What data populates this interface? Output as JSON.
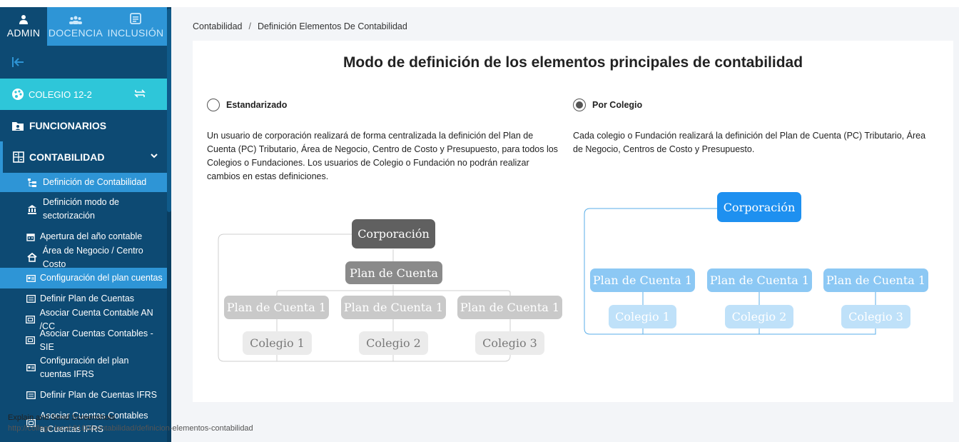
{
  "sidebar": {
    "tabs": [
      {
        "label": "ADMIN",
        "icon": "admin-user-icon"
      },
      {
        "label": "DOCENCIA",
        "icon": "group-icon"
      },
      {
        "label": "INCLUSIÓN",
        "icon": "id-card-icon"
      }
    ],
    "back_icon": "arrow-left-icon",
    "colegio": {
      "label": "COLEGIO 12-2",
      "icon": "palette-icon",
      "swap_icon": "swap-icon"
    },
    "funcionarios": {
      "label": "FUNCIONARIOS",
      "icon": "folder-user-icon"
    },
    "contabilidad": {
      "label": "CONTABILIDAD",
      "icon": "calculator-icon",
      "chevron": "chevron-down-icon"
    },
    "sub_items": [
      {
        "label": "Definición de Contabilidad",
        "active": true,
        "icon": "tree-icon"
      },
      {
        "label": "Definición modo de sectorización",
        "active": false,
        "icon": "bank-icon"
      },
      {
        "label": "Apertura del año contable",
        "active": false,
        "icon": "calendar-icon"
      },
      {
        "label": "Área de Negocio / Centro Costo",
        "active": false,
        "icon": "home-icon"
      },
      {
        "label": "Configuración del plan cuentas",
        "active": true,
        "icon": "card-icon"
      },
      {
        "label": "Definir Plan de Cuentas",
        "active": false,
        "icon": "list-icon"
      },
      {
        "label": "Asociar Cuenta Contable AN /CC",
        "active": false,
        "icon": "link-box-icon"
      },
      {
        "label": "Asociar Cuentas Contables - SIE",
        "active": false,
        "icon": "link-box-icon"
      },
      {
        "label": "Configuración del plan cuentas IFRS",
        "active": false,
        "icon": "card-icon"
      },
      {
        "label": "Definir Plan de Cuentas IFRS",
        "active": false,
        "icon": "list-icon"
      },
      {
        "label": "Asociar Cuentas Contables a Cuentas IFRS",
        "active": false,
        "icon": "link-box-icon"
      }
    ]
  },
  "breadcrumb": {
    "root": "Contabilidad",
    "separator": "/",
    "current": "Definición Elementos De Contabilidad"
  },
  "main": {
    "title": "Modo de definición de los elementos principales de contabilidad",
    "options": [
      {
        "label": "Estandarizado",
        "selected": false,
        "description": "Un usuario de corporación realizará de forma centralizada la definición del Plan de Cuenta (PC) Tributario, Área de Negocio, Centro de Costo y Presupuesto, para todos los Colegios o Fundaciones. Los usuarios de Colegio o Fundación no podrán realizar cambios en estas definiciones.",
        "diagram": {
          "root": "Corporación",
          "plan": "Plan de Cuenta",
          "plans": [
            "Plan de Cuenta 1",
            "Plan de Cuenta 1",
            "Plan de Cuenta 1"
          ],
          "schools": [
            "Colegio 1",
            "Colegio 2",
            "Colegio 3"
          ]
        }
      },
      {
        "label": "Por Colegio",
        "selected": true,
        "description": "Cada colegio o Fundación realizará la definición del Plan de Cuenta (PC) Tributario, Área de Negocio, Centros de Costo y Presupuesto.",
        "diagram": {
          "root": "Corporación",
          "plans": [
            "Plan de Cuenta 1",
            "Plan de Cuenta 1",
            "Plan de Cuenta 1"
          ],
          "schools": [
            "Colegio 1",
            "Colegio 2",
            "Colegio 3"
          ]
        }
      }
    ]
  },
  "status_bar": {
    "tooltip": "Explain and Send Screenshots",
    "url": "http://college.local:8100/contabilidad/definicion-elementos-contabilidad"
  },
  "colors": {
    "sidebar": "#0d4a73",
    "accent": "#2e95d6",
    "colegio": "#2ec6d9",
    "gray_root": "#606060",
    "blue_root": "#1e90f0"
  }
}
